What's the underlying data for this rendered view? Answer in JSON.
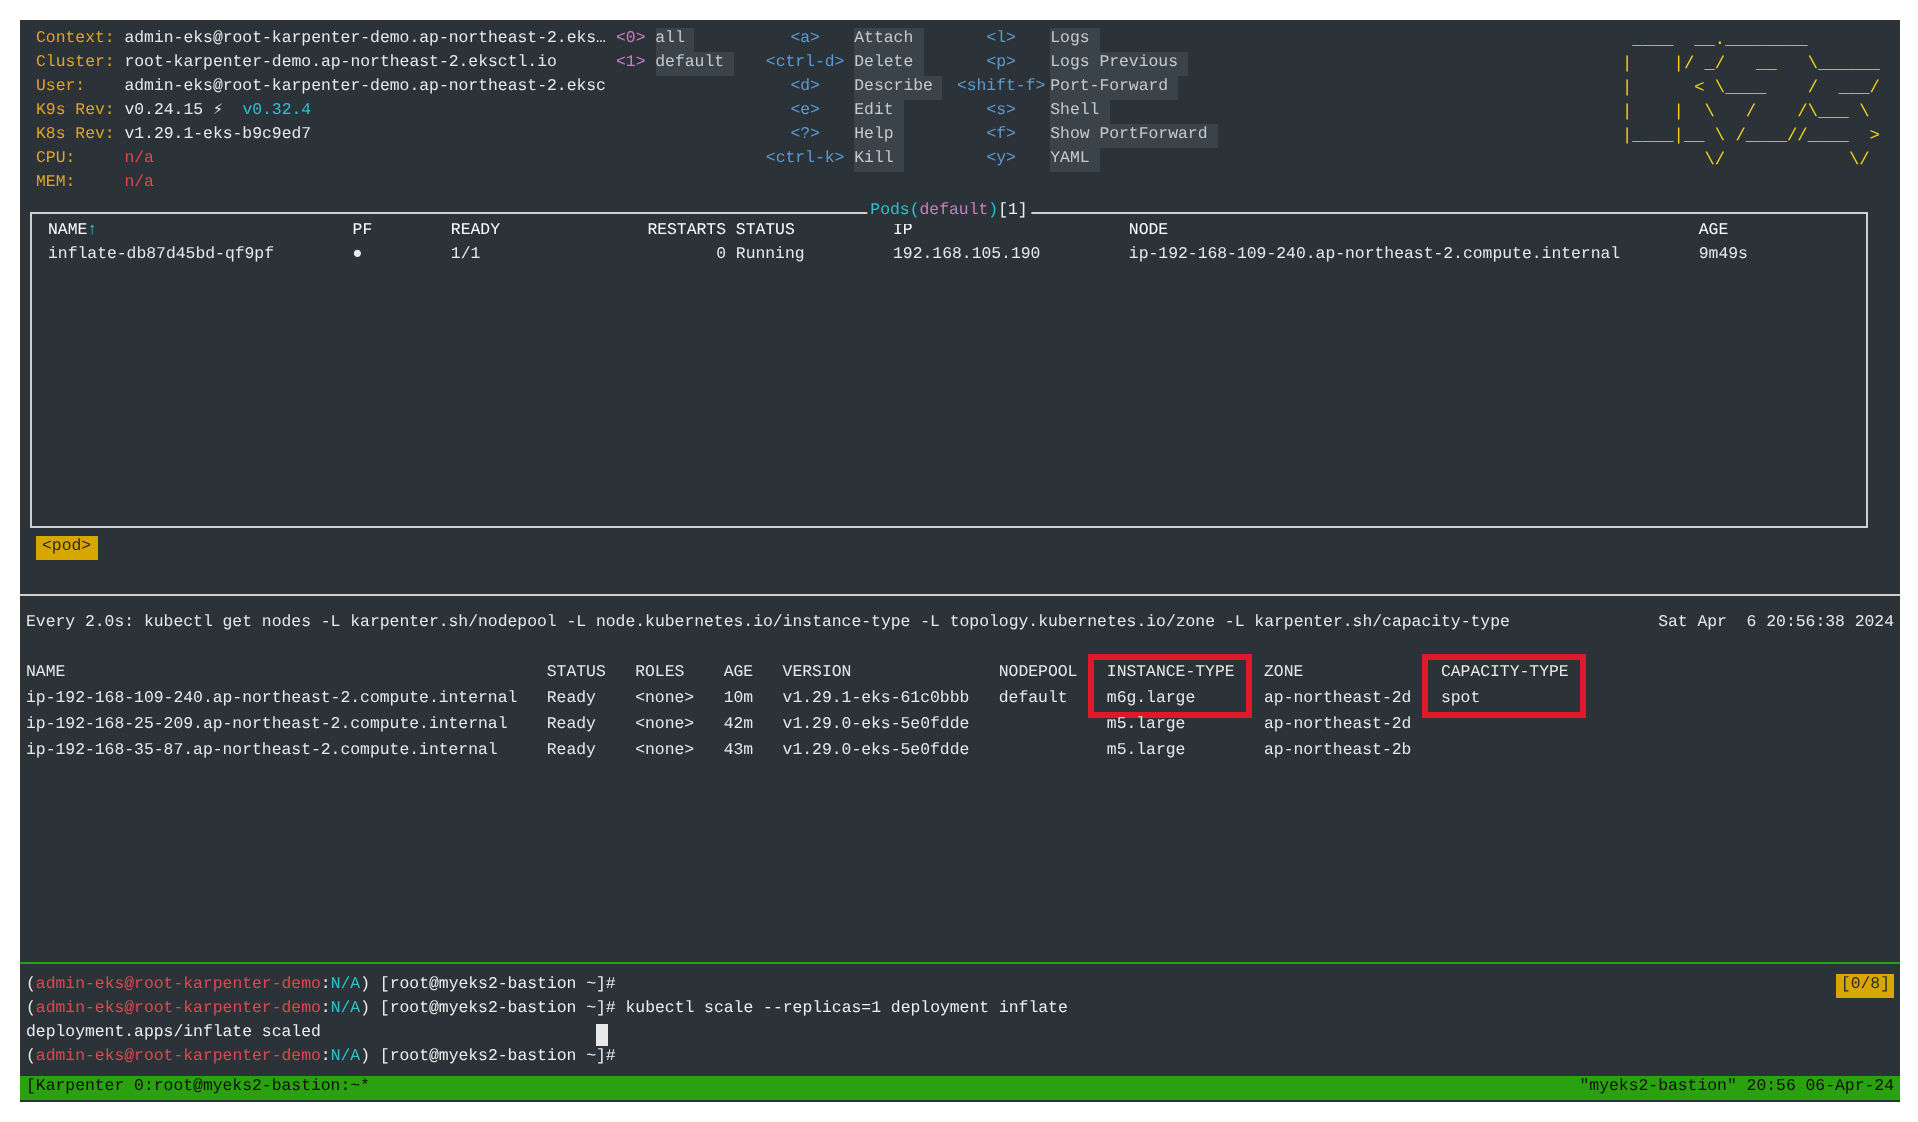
{
  "k9s": {
    "info": [
      {
        "label": "Context:",
        "value": "admin-eks@root-karpenter-demo.ap-northeast-2.eks…",
        "kind": "plain"
      },
      {
        "label": "Cluster:",
        "value": "root-karpenter-demo.ap-northeast-2.eksctl.io",
        "kind": "plain"
      },
      {
        "label": "User:",
        "value": "admin-eks@root-karpenter-demo.ap-northeast-2.eksc",
        "kind": "plain"
      },
      {
        "label": "K9s Rev:",
        "value": "v0.24.15 ⚡",
        "update": "v0.32.4",
        "kind": "plain"
      },
      {
        "label": "K8s Rev:",
        "value": "v1.29.1-eks-b9c9ed7",
        "kind": "plain"
      },
      {
        "label": "CPU:",
        "value": "n/a",
        "kind": "unavailable"
      },
      {
        "label": "MEM:",
        "value": "n/a",
        "kind": "unavailable"
      }
    ],
    "namespaces": [
      {
        "key": "<0>",
        "name": "all"
      },
      {
        "key": "<1>",
        "name": "default"
      }
    ],
    "hotkey_columns": [
      [
        {
          "key": "<a>",
          "action": "Attach"
        },
        {
          "key": "<ctrl-d>",
          "action": "Delete"
        },
        {
          "key": "<d>",
          "action": "Describe"
        },
        {
          "key": "<e>",
          "action": "Edit"
        },
        {
          "key": "<?>",
          "action": "Help"
        },
        {
          "key": "<ctrl-k>",
          "action": "Kill"
        }
      ],
      [
        {
          "key": "<l>",
          "action": "Logs"
        },
        {
          "key": "<p>",
          "action": "Logs Previous"
        },
        {
          "key": "<shift-f>",
          "action": "Port-Forward"
        },
        {
          "key": "<s>",
          "action": "Shell"
        },
        {
          "key": "<f>",
          "action": "Show PortForward"
        },
        {
          "key": "<y>",
          "action": "YAML"
        }
      ]
    ],
    "logo": [
      " ____  __.________       ",
      "|    |/ _/   __   \\______",
      "|      < \\____    /  ___/",
      "|    |  \\   /    /\\___ \\ ",
      "|____|__ \\ /____//____  >",
      "        \\/            \\/ "
    ]
  },
  "pods": {
    "title_parts": [
      {
        "text": "Pods(",
        "kind": "resource"
      },
      {
        "text": "default",
        "kind": "namespace"
      },
      {
        "text": ")",
        "kind": "resource"
      },
      {
        "text": "[1]",
        "kind": "count"
      }
    ],
    "columns": [
      {
        "label": "NAME",
        "sort_mark": "↑"
      },
      {
        "label": "PF"
      },
      {
        "label": "READY"
      },
      {
        "label": "RESTARTS"
      },
      {
        "label": "STATUS"
      },
      {
        "label": "IP"
      },
      {
        "label": "NODE"
      },
      {
        "label": "AGE"
      }
    ],
    "rows": [
      [
        "inflate-db87d45bd-qf9pf",
        "●",
        "1/1",
        "0",
        "Running",
        "192.168.105.190",
        "ip-192-168-109-240.ap-northeast-2.compute.internal",
        "9m49s"
      ]
    ]
  },
  "crumbs": [
    "<pod>"
  ],
  "watch": {
    "command": "Every 2.0s: kubectl get nodes -L karpenter.sh/nodepool -L node.kubernetes.io/instance-type -L topology.kubernetes.io/zone -L karpenter.sh/capacity-type",
    "time": "Sat Apr  6 20:56:38 2024",
    "columns": [
      {
        "label": "NAME",
        "highlighted": false
      },
      {
        "label": "STATUS",
        "highlighted": false
      },
      {
        "label": "ROLES",
        "highlighted": false
      },
      {
        "label": "AGE",
        "highlighted": false
      },
      {
        "label": "VERSION",
        "highlighted": false
      },
      {
        "label": "NODEPOOL",
        "highlighted": false
      },
      {
        "label": "INSTANCE-TYPE",
        "highlighted": true
      },
      {
        "label": "ZONE",
        "highlighted": false
      },
      {
        "label": "CAPACITY-TYPE",
        "highlighted": true
      }
    ],
    "rows": [
      [
        "ip-192-168-109-240.ap-northeast-2.compute.internal",
        "Ready",
        "<none>",
        "10m",
        "v1.29.1-eks-61c0bbb",
        "default",
        "m6g.large",
        "ap-northeast-2d",
        "spot"
      ],
      [
        "ip-192-168-25-209.ap-northeast-2.compute.internal",
        "Ready",
        "<none>",
        "42m",
        "v1.29.0-eks-5e0fdde",
        "",
        "m5.large",
        "ap-northeast-2d",
        ""
      ],
      [
        "ip-192-168-35-87.ap-northeast-2.compute.internal",
        "Ready",
        "<none>",
        "43m",
        "v1.29.0-eks-5e0fdde",
        "",
        "m5.large",
        "ap-northeast-2b",
        ""
      ]
    ]
  },
  "shell": {
    "pane_counter": "[0/8]",
    "lines": [
      {
        "cursor": false,
        "segments": [
          {
            "text": "(",
            "kind": "plain"
          },
          {
            "text": "admin-eks@root-karpenter-demo",
            "kind": "user"
          },
          {
            "text": ":",
            "kind": "plain"
          },
          {
            "text": "N/A",
            "kind": "namespace"
          },
          {
            "text": ") [root@myeks2-bastion ~]#",
            "kind": "plain"
          }
        ]
      },
      {
        "cursor": false,
        "segments": [
          {
            "text": "(",
            "kind": "plain"
          },
          {
            "text": "admin-eks@root-karpenter-demo",
            "kind": "user"
          },
          {
            "text": ":",
            "kind": "plain"
          },
          {
            "text": "N/A",
            "kind": "namespace"
          },
          {
            "text": ") [root@myeks2-bastion ~]# kubectl scale --replicas=1 deployment inflate",
            "kind": "plain"
          }
        ]
      },
      {
        "cursor": true,
        "segments": [
          {
            "text": "deployment.apps/inflate scaled",
            "kind": "plain"
          }
        ]
      },
      {
        "cursor": false,
        "segments": [
          {
            "text": "(",
            "kind": "plain"
          },
          {
            "text": "admin-eks@root-karpenter-demo",
            "kind": "user"
          },
          {
            "text": ":",
            "kind": "plain"
          },
          {
            "text": "N/A",
            "kind": "namespace"
          },
          {
            "text": ") [root@myeks2-bastion ~]#",
            "kind": "plain"
          }
        ]
      }
    ]
  },
  "status_bar": {
    "left": "[Karpenter 0:root@myeks2-bastion:~*",
    "right": "\"myeks2-bastion\" 20:56 06-Apr-24"
  }
}
